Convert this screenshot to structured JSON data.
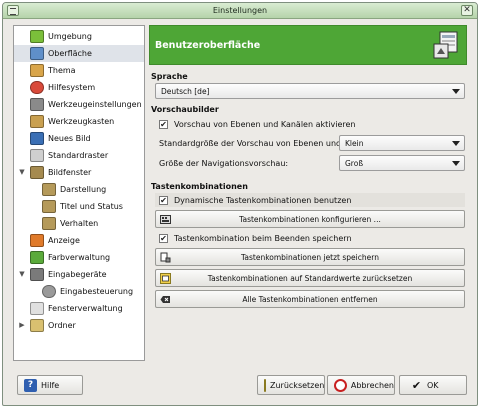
{
  "window": {
    "title": "Einstellungen"
  },
  "sidebar": {
    "items": [
      {
        "label": "Umgebung",
        "color": "#7bbf3a"
      },
      {
        "label": "Oberfläche",
        "color": "#5f8fc9"
      },
      {
        "label": "Thema",
        "color": "#d9a54a"
      },
      {
        "label": "Hilfesystem",
        "color": "#d94a3a"
      },
      {
        "label": "Werkzeugeinstellungen",
        "color": "#8a8a8a"
      },
      {
        "label": "Werkzeugkasten",
        "color": "#c9a050"
      },
      {
        "label": "Neues Bild",
        "color": "#3a6fb5"
      },
      {
        "label": "Standardraster",
        "color": "#cfcfcf"
      },
      {
        "label": "Bildfenster",
        "color": "#a58a4f"
      },
      {
        "label": "Darstellung",
        "color": "#b59a5a"
      },
      {
        "label": "Titel und Status",
        "color": "#b59a5a"
      },
      {
        "label": "Verhalten",
        "color": "#b59a5a"
      },
      {
        "label": "Anzeige",
        "color": "#e07a2a"
      },
      {
        "label": "Farbverwaltung",
        "color": "#5aaa3a"
      },
      {
        "label": "Eingabegeräte",
        "color": "#7a7a7a"
      },
      {
        "label": "Eingabesteuerung",
        "color": "#9a9a9a"
      },
      {
        "label": "Fensterverwaltung",
        "color": "#e0e0e0"
      },
      {
        "label": "Ordner",
        "color": "#d9c070"
      }
    ]
  },
  "header": {
    "title": "Benutzeroberfläche",
    "color": "#4ea636"
  },
  "sprache": {
    "heading": "Sprache",
    "value": "Deutsch [de]"
  },
  "vorschaubilder": {
    "heading": "Vorschaubilder",
    "enable_label": "Vorschau von Ebenen und Kanälen aktivieren",
    "enable_checked": true,
    "size_label": "Standardgröße der Vorschau von Ebenen und Kanälen:",
    "size_value": "Klein",
    "nav_label": "Größe der Navigationsvorschau:",
    "nav_value": "Groß"
  },
  "tasten": {
    "heading": "Tastenkombinationen",
    "dynamic_label": "Dynamische Tastenkombinationen benutzen",
    "dynamic_checked": true,
    "configure_button": "Tastenkombinationen konfigurieren ...",
    "save_on_exit_label": "Tastenkombination beim Beenden speichern",
    "save_on_exit_checked": true,
    "save_now_button": "Tastenkombinationen jetzt speichern",
    "reset_button": "Tastenkombinationen auf Standardwerte zurücksetzen",
    "remove_button": "Alle Tastenkombinationen entfernen"
  },
  "footer": {
    "help": "Hilfe",
    "reset": "Zurücksetzen",
    "cancel": "Abbrechen",
    "ok": "OK"
  }
}
